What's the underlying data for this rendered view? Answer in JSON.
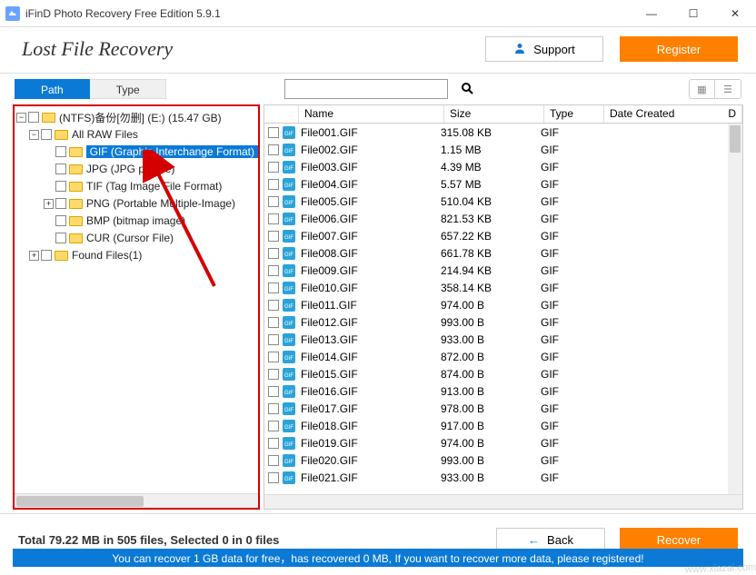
{
  "window": {
    "title": "iFinD Photo Recovery Free Edition 5.9.1"
  },
  "header": {
    "title": "Lost File Recovery",
    "support": "Support",
    "register": "Register"
  },
  "tabs": {
    "path": "Path",
    "type": "Type"
  },
  "search": {
    "placeholder": ""
  },
  "tree": {
    "root": "(NTFS)备份[勿删] (E:) (15.47 GB)",
    "allraw": "All RAW Files",
    "items": [
      "GIF (Graphic Interchange Format)",
      "JPG (JPG picture)",
      "TIF (Tag Image File Format)",
      "PNG (Portable Multiple-Image)",
      "BMP (bitmap image)",
      "CUR (Cursor File)"
    ],
    "found": "Found Files(1)"
  },
  "grid": {
    "headers": {
      "name": "Name",
      "size": "Size",
      "type": "Type",
      "date": "Date Created",
      "d2": "D"
    },
    "rows": [
      {
        "name": "File001.GIF",
        "size": "315.08 KB",
        "type": "GIF"
      },
      {
        "name": "File002.GIF",
        "size": "1.15 MB",
        "type": "GIF"
      },
      {
        "name": "File003.GIF",
        "size": "4.39 MB",
        "type": "GIF"
      },
      {
        "name": "File004.GIF",
        "size": "5.57 MB",
        "type": "GIF"
      },
      {
        "name": "File005.GIF",
        "size": "510.04 KB",
        "type": "GIF"
      },
      {
        "name": "File006.GIF",
        "size": "821.53 KB",
        "type": "GIF"
      },
      {
        "name": "File007.GIF",
        "size": "657.22 KB",
        "type": "GIF"
      },
      {
        "name": "File008.GIF",
        "size": "661.78 KB",
        "type": "GIF"
      },
      {
        "name": "File009.GIF",
        "size": "214.94 KB",
        "type": "GIF"
      },
      {
        "name": "File010.GIF",
        "size": "358.14 KB",
        "type": "GIF"
      },
      {
        "name": "File011.GIF",
        "size": "974.00 B",
        "type": "GIF"
      },
      {
        "name": "File012.GIF",
        "size": "993.00 B",
        "type": "GIF"
      },
      {
        "name": "File013.GIF",
        "size": "933.00 B",
        "type": "GIF"
      },
      {
        "name": "File014.GIF",
        "size": "872.00 B",
        "type": "GIF"
      },
      {
        "name": "File015.GIF",
        "size": "874.00 B",
        "type": "GIF"
      },
      {
        "name": "File016.GIF",
        "size": "913.00 B",
        "type": "GIF"
      },
      {
        "name": "File017.GIF",
        "size": "978.00 B",
        "type": "GIF"
      },
      {
        "name": "File018.GIF",
        "size": "917.00 B",
        "type": "GIF"
      },
      {
        "name": "File019.GIF",
        "size": "974.00 B",
        "type": "GIF"
      },
      {
        "name": "File020.GIF",
        "size": "993.00 B",
        "type": "GIF"
      },
      {
        "name": "File021.GIF",
        "size": "933.00 B",
        "type": "GIF"
      }
    ]
  },
  "footer": {
    "status": "Total 79.22 MB in 505 files,  Selected 0 in 0 files",
    "back": "Back",
    "recover": "Recover",
    "blue": "You can recover 1 GB data for free，has recovered 0 MB, If you want to recover more data, please registered!"
  }
}
